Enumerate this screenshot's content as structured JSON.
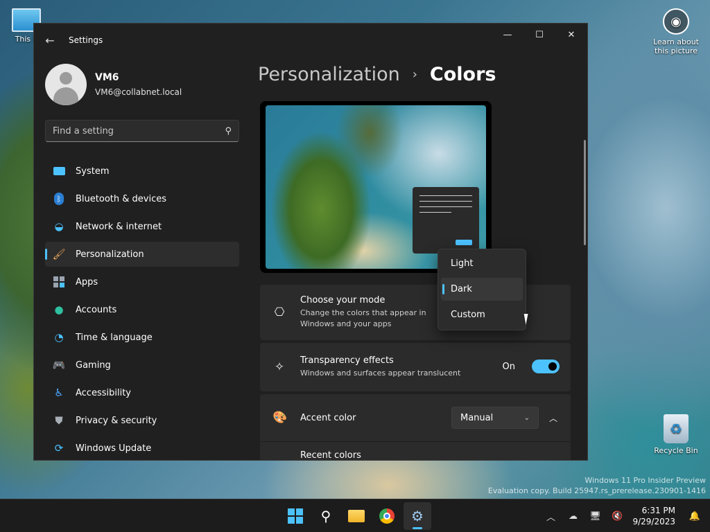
{
  "desktop": {
    "this_pc_label": "This P",
    "learn_label": "Learn about this picture",
    "recycle_label": "Recycle Bin",
    "watermark_line1": "Windows 11 Pro Insider Preview",
    "watermark_line2": "Evaluation copy. Build 25947.rs_prerelease.230901-1416"
  },
  "window": {
    "title": "Settings",
    "minimize": "—",
    "maximize": "☐",
    "close": "✕"
  },
  "profile": {
    "name": "VM6",
    "email": "VM6@collabnet.local"
  },
  "search": {
    "placeholder": "Find a setting"
  },
  "nav": {
    "items": [
      {
        "label": "System",
        "icon": "monitor-icon"
      },
      {
        "label": "Bluetooth & devices",
        "icon": "bluetooth-icon"
      },
      {
        "label": "Network & internet",
        "icon": "wifi-icon"
      },
      {
        "label": "Personalization",
        "icon": "brush-icon"
      },
      {
        "label": "Apps",
        "icon": "apps-icon"
      },
      {
        "label": "Accounts",
        "icon": "person-icon"
      },
      {
        "label": "Time & language",
        "icon": "globe-clock-icon"
      },
      {
        "label": "Gaming",
        "icon": "gamepad-icon"
      },
      {
        "label": "Accessibility",
        "icon": "accessibility-icon"
      },
      {
        "label": "Privacy & security",
        "icon": "shield-icon"
      },
      {
        "label": "Windows Update",
        "icon": "update-icon"
      }
    ],
    "active_index": 3
  },
  "breadcrumb": {
    "parent": "Personalization",
    "separator": "›",
    "current": "Colors"
  },
  "mode_card": {
    "title": "Choose your mode",
    "description": "Change the colors that appear in Windows and your apps"
  },
  "transparency_card": {
    "title": "Transparency effects",
    "description": "Windows and surfaces appear translucent",
    "state_label": "On"
  },
  "accent_card": {
    "title": "Accent color",
    "dropdown_value": "Manual",
    "recent_label": "Recent colors"
  },
  "mode_popup": {
    "options": [
      "Light",
      "Dark",
      "Custom"
    ],
    "selected": "Dark"
  },
  "taskbar": {
    "time": "6:31 PM",
    "date": "9/29/2023"
  },
  "colors": {
    "accent": "#4cc2ff",
    "window_bg": "#202020",
    "card_bg": "#2b2b2b"
  }
}
